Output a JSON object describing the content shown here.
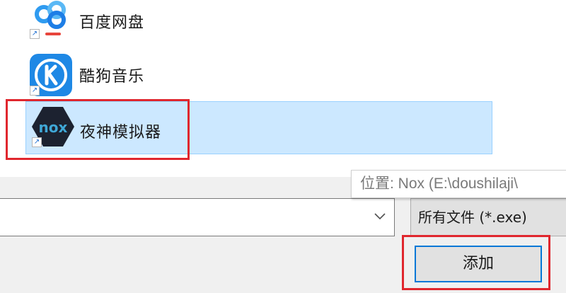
{
  "files": [
    {
      "label": "百度网盘",
      "icon": "baidu-netdisk-icon",
      "selected": false
    },
    {
      "label": "酷狗音乐",
      "icon": "kugou-music-icon",
      "selected": false
    },
    {
      "label": "夜神模拟器",
      "icon": "nox-emulator-icon",
      "selected": true,
      "icon_text": "nox"
    }
  ],
  "shortcut_glyph": "↗",
  "tooltip": {
    "text": "位置: Nox (E:\\doushilaji\\"
  },
  "filename": {
    "value": ""
  },
  "filetype": {
    "selected": "所有文件 (*.exe)"
  },
  "add_button": {
    "label": "添加"
  },
  "colors": {
    "selection_bg": "#cce8ff",
    "highlight_red": "#e0272e",
    "button_border": "#0078d7",
    "kugou_blue": "#1e88e5"
  }
}
